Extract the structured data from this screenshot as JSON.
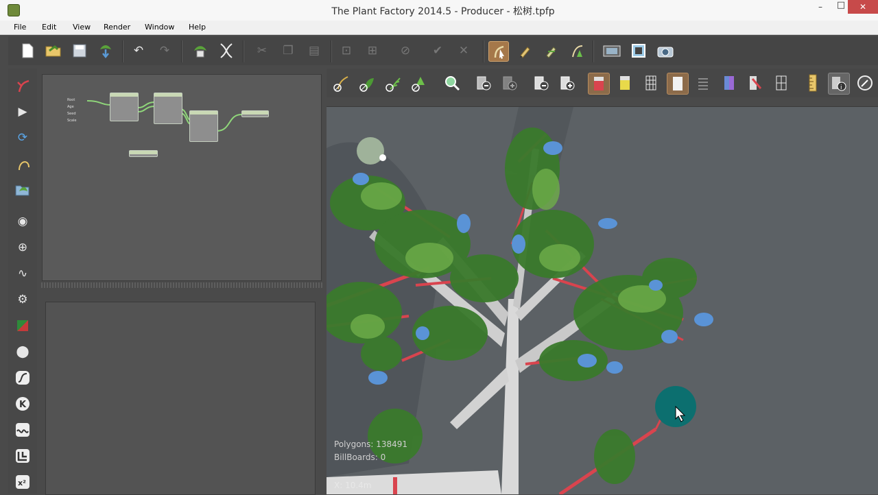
{
  "window": {
    "title": "The Plant Factory 2014.5 - Producer - 松树.tpfp",
    "minimize": "–",
    "maximize": "□",
    "close": "✕"
  },
  "menu": {
    "file": "File",
    "edit": "Edit",
    "view": "View",
    "render": "Render",
    "window": "Window",
    "help": "Help"
  },
  "icons": {
    "new": "new-document-icon",
    "open": "open-folder-icon",
    "save": "save-icon",
    "export": "export-plant-icon",
    "undo": "undo-icon",
    "redo": "redo-icon",
    "random_seed": "random-seed-icon",
    "dna": "dna-icon",
    "cut": "cut-icon",
    "copy": "copy-icon",
    "paste": "paste-icon"
  },
  "graph_nodes": {
    "root_ports": [
      "Root",
      "Age",
      "Seed",
      "Scale"
    ]
  },
  "viewport": {
    "polygons_label": "Polygons: 138491",
    "billboards_label": "BillBoards: 0",
    "coord_label": "X: 10.4m"
  },
  "colors": {
    "active_tool": "#a5784a",
    "viewport_bg": "#5c6165",
    "branch_red": "#d9444e",
    "leaf_green": "#3a7a2c",
    "leaf_blue": "#5a93d6",
    "cursor_teal": "#0c6f6f"
  }
}
